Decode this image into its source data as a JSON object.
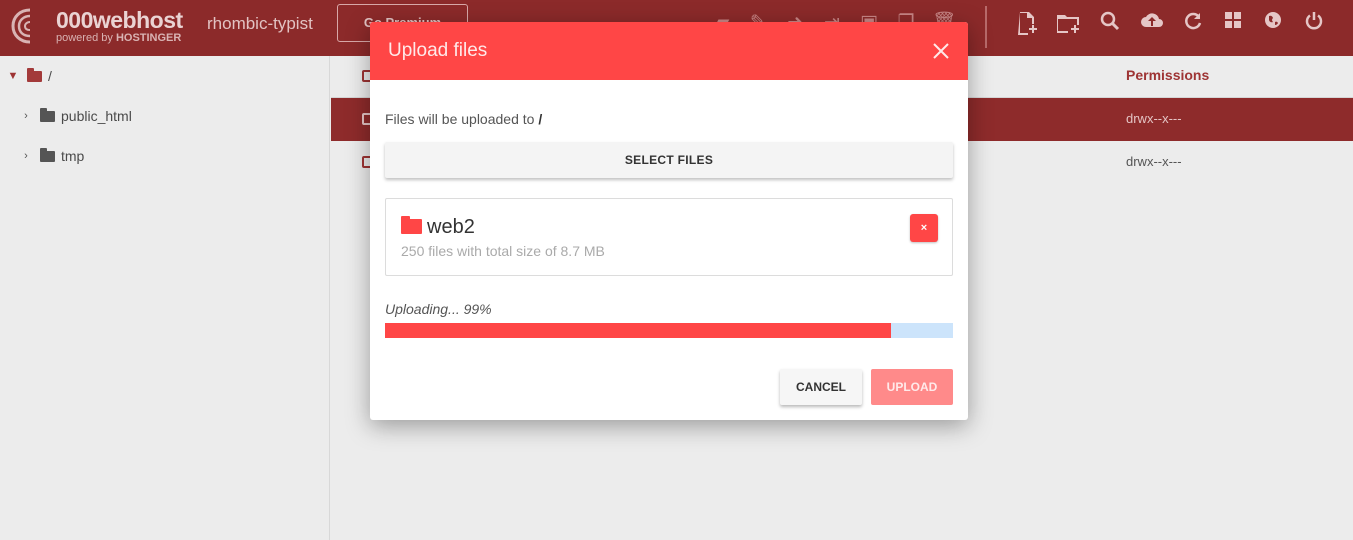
{
  "header": {
    "brand_name": "000webhost",
    "brand_powered_prefix": "powered by ",
    "brand_powered_company": "HOSTINGER",
    "site_name": "rhombic-typist",
    "premium_label": "Go Premium",
    "toolbar_icons": [
      "folder-open-icon",
      "edit-icon",
      "move-icon",
      "rename-icon",
      "permissions-icon",
      "copy-icon",
      "delete-icon"
    ],
    "right_icons": [
      "new-file-icon",
      "new-folder-icon",
      "search-icon",
      "upload-icon",
      "refresh-icon",
      "grid-view-icon",
      "globe-icon",
      "power-icon"
    ]
  },
  "sidebar": {
    "root_label": "/",
    "items": [
      {
        "label": "public_html"
      },
      {
        "label": "tmp"
      }
    ]
  },
  "table": {
    "permissions_header": "Permissions",
    "rows": [
      {
        "permissions": "drwx--x---",
        "selected": true
      },
      {
        "permissions": "drwx--x---",
        "selected": false
      }
    ]
  },
  "modal": {
    "title": "Upload files",
    "destination_prefix": "Files will be uploaded to ",
    "destination_path": "/",
    "select_files_label": "SELECT FILES",
    "file": {
      "name": "web2",
      "info": "250 files with total size of 8.7 MB",
      "remove_label": "×"
    },
    "progress_label": "Uploading... 99%",
    "progress_percent": 99,
    "cancel_label": "CANCEL",
    "upload_label": "UPLOAD"
  },
  "colors": {
    "accent": "#ff4646",
    "header_bg": "#8c2a2a",
    "progress_track": "#cce4fb"
  }
}
